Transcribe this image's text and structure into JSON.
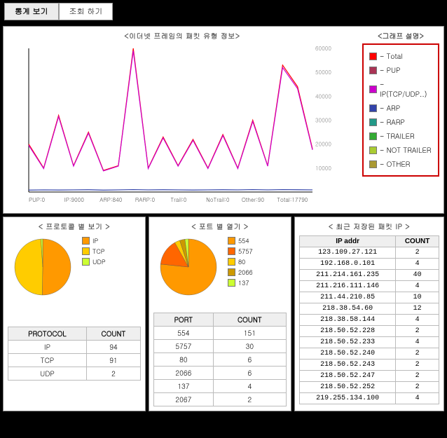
{
  "tabs": {
    "active": "통계 보기",
    "inactive": "조회 하기"
  },
  "line_chart_title": "<이더넷 프레임의 패킷 유형 정보>",
  "legend_title": "<그래프 설명>",
  "legend_items": [
    {
      "label": "Total",
      "color": "#ff0000"
    },
    {
      "label": "PUP",
      "color": "#aa3355"
    },
    {
      "label": "IP(TCP/UDP..)",
      "color": "#cc00cc"
    },
    {
      "label": "ARP",
      "color": "#3344aa"
    },
    {
      "label": "RARP",
      "color": "#229988"
    },
    {
      "label": "TRAILER",
      "color": "#33aa33"
    },
    {
      "label": "NOT TRAILER",
      "color": "#aacc33"
    },
    {
      "label": "OTHER",
      "color": "#aa9933"
    }
  ],
  "chart_data": {
    "line": {
      "type": "line",
      "title": "<이더넷 프레임의 패킷 유형 정보>",
      "ylim": [
        0,
        60000
      ],
      "yticks": [
        10000,
        20000,
        30000,
        40000,
        50000,
        60000
      ],
      "x_categories_labels": [
        "PUP:0",
        "IP:9000",
        "ARP:840",
        "RARP:0",
        "Trail:0",
        "NoTrail:0",
        "Other:90",
        "Total:17790"
      ],
      "series": [
        {
          "name": "Total",
          "color": "#ff0000",
          "values": [
            20000,
            10000,
            32000,
            11000,
            25000,
            9000,
            11000,
            60000,
            10000,
            23000,
            11000,
            22000,
            10000,
            24000,
            10000,
            30000,
            11000,
            53000,
            44000,
            18000
          ]
        },
        {
          "name": "IP(TCP/UDP..)",
          "color": "#cc00cc",
          "values": [
            19500,
            9800,
            31500,
            10800,
            24600,
            8800,
            10800,
            59000,
            9800,
            22600,
            10800,
            21600,
            9800,
            23600,
            9800,
            29500,
            10800,
            52000,
            43200,
            17600
          ]
        },
        {
          "name": "ARP",
          "color": "#3344aa",
          "values": [
            800,
            900,
            850,
            900,
            950,
            800,
            900,
            1000,
            900,
            950,
            900,
            850,
            900,
            950,
            900,
            1000,
            900,
            1000,
            950,
            900
          ]
        }
      ]
    },
    "protocol_pie": {
      "type": "pie",
      "title": "< 프로토콜 별 보기 >",
      "slices": [
        {
          "label": "IP",
          "value": 94,
          "color": "#ff9900"
        },
        {
          "label": "TCP",
          "value": 91,
          "color": "#ffcc00"
        },
        {
          "label": "UDP",
          "value": 2,
          "color": "#ccff33"
        }
      ]
    },
    "port_pie": {
      "type": "pie",
      "title": "< 포트 별 열기 >",
      "slices": [
        {
          "label": "554",
          "value": 151,
          "color": "#ff9900"
        },
        {
          "label": "5757",
          "value": 30,
          "color": "#ff6600"
        },
        {
          "label": "80",
          "value": 6,
          "color": "#ffcc00"
        },
        {
          "label": "2066",
          "value": 6,
          "color": "#cc9900"
        },
        {
          "label": "137",
          "value": 4,
          "color": "#ccff33"
        }
      ]
    }
  },
  "protocol_table": {
    "headers": [
      "PROTOCOL",
      "COUNT"
    ],
    "rows": [
      [
        "IP",
        "94"
      ],
      [
        "TCP",
        "91"
      ],
      [
        "UDP",
        "2"
      ]
    ]
  },
  "port_table": {
    "headers": [
      "PORT",
      "COUNT"
    ],
    "rows": [
      [
        "554",
        "151"
      ],
      [
        "5757",
        "30"
      ],
      [
        "80",
        "6"
      ],
      [
        "2066",
        "6"
      ],
      [
        "137",
        "4"
      ],
      [
        "2067",
        "2"
      ]
    ]
  },
  "ip_card_title": "< 최근 저장된 패킷 IP >",
  "ip_table": {
    "headers": [
      "IP addr",
      "COUNT"
    ],
    "rows": [
      [
        "123.109.27.121",
        "2"
      ],
      [
        "192.168.0.101",
        "4"
      ],
      [
        "211.214.161.235",
        "40"
      ],
      [
        "211.216.111.146",
        "4"
      ],
      [
        "211.44.210.85",
        "10"
      ],
      [
        "218.38.54.60",
        "12"
      ],
      [
        "218.38.58.144",
        "4"
      ],
      [
        "218.50.52.228",
        "2"
      ],
      [
        "218.50.52.233",
        "4"
      ],
      [
        "218.50.52.240",
        "2"
      ],
      [
        "218.50.52.243",
        "2"
      ],
      [
        "218.50.52.247",
        "2"
      ],
      [
        "218.50.52.252",
        "2"
      ],
      [
        "219.255.134.100",
        "4"
      ]
    ]
  }
}
